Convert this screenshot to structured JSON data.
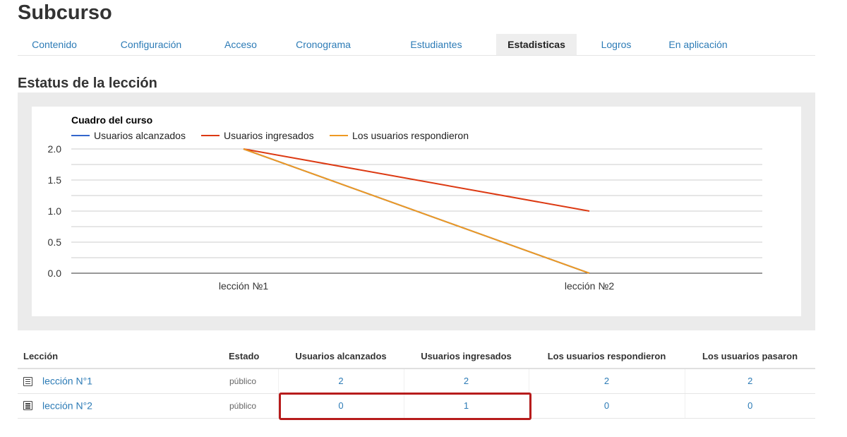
{
  "page": {
    "title": "Subcurso"
  },
  "tabs": [
    {
      "label": "Contenido",
      "active": false
    },
    {
      "label": "Configuración",
      "active": false
    },
    {
      "label": "Acceso",
      "active": false
    },
    {
      "label": "Cronograma",
      "active": false
    },
    {
      "label": "Estudiantes",
      "active": false
    },
    {
      "label": "Estadisticas",
      "active": true
    },
    {
      "label": "Logros",
      "active": false
    },
    {
      "label": "En aplicación",
      "active": false
    }
  ],
  "section": {
    "title": "Estatus de la lección"
  },
  "chart_data": {
    "type": "line",
    "title": "Cuadro del curso",
    "categories": [
      "lección №1",
      "lección №2"
    ],
    "yticks": [
      "2.0",
      "1.5",
      "1.0",
      "0.5",
      "0.0"
    ],
    "ylim": [
      0,
      2
    ],
    "grid": true,
    "legend_position": "top-left",
    "series": [
      {
        "name": "Usuarios alcanzados",
        "color": "#3366cc",
        "values": [
          2,
          0
        ]
      },
      {
        "name": "Usuarios ingresados",
        "color": "#dc3912",
        "values": [
          2,
          1
        ]
      },
      {
        "name": "Los usuarios respondieron",
        "color": "#ee9922",
        "values": [
          2,
          0
        ]
      }
    ]
  },
  "table": {
    "headers": {
      "lesson": "Lección",
      "state": "Estado",
      "reached": "Usuarios alcanzados",
      "entered": "Usuarios ingresados",
      "answered": "Los usuarios respondieron",
      "passed": "Los usuarios pasaron"
    },
    "rows": [
      {
        "lesson": "lección N°1",
        "state": "público",
        "reached": "2",
        "entered": "2",
        "answered": "2",
        "passed": "2"
      },
      {
        "lesson": "lección N°2",
        "state": "público",
        "reached": "0",
        "entered": "1",
        "answered": "0",
        "passed": "0"
      }
    ]
  },
  "colors": {
    "link": "#2c7bb6",
    "highlight": "#b71c1c",
    "panel": "#ebebeb"
  }
}
